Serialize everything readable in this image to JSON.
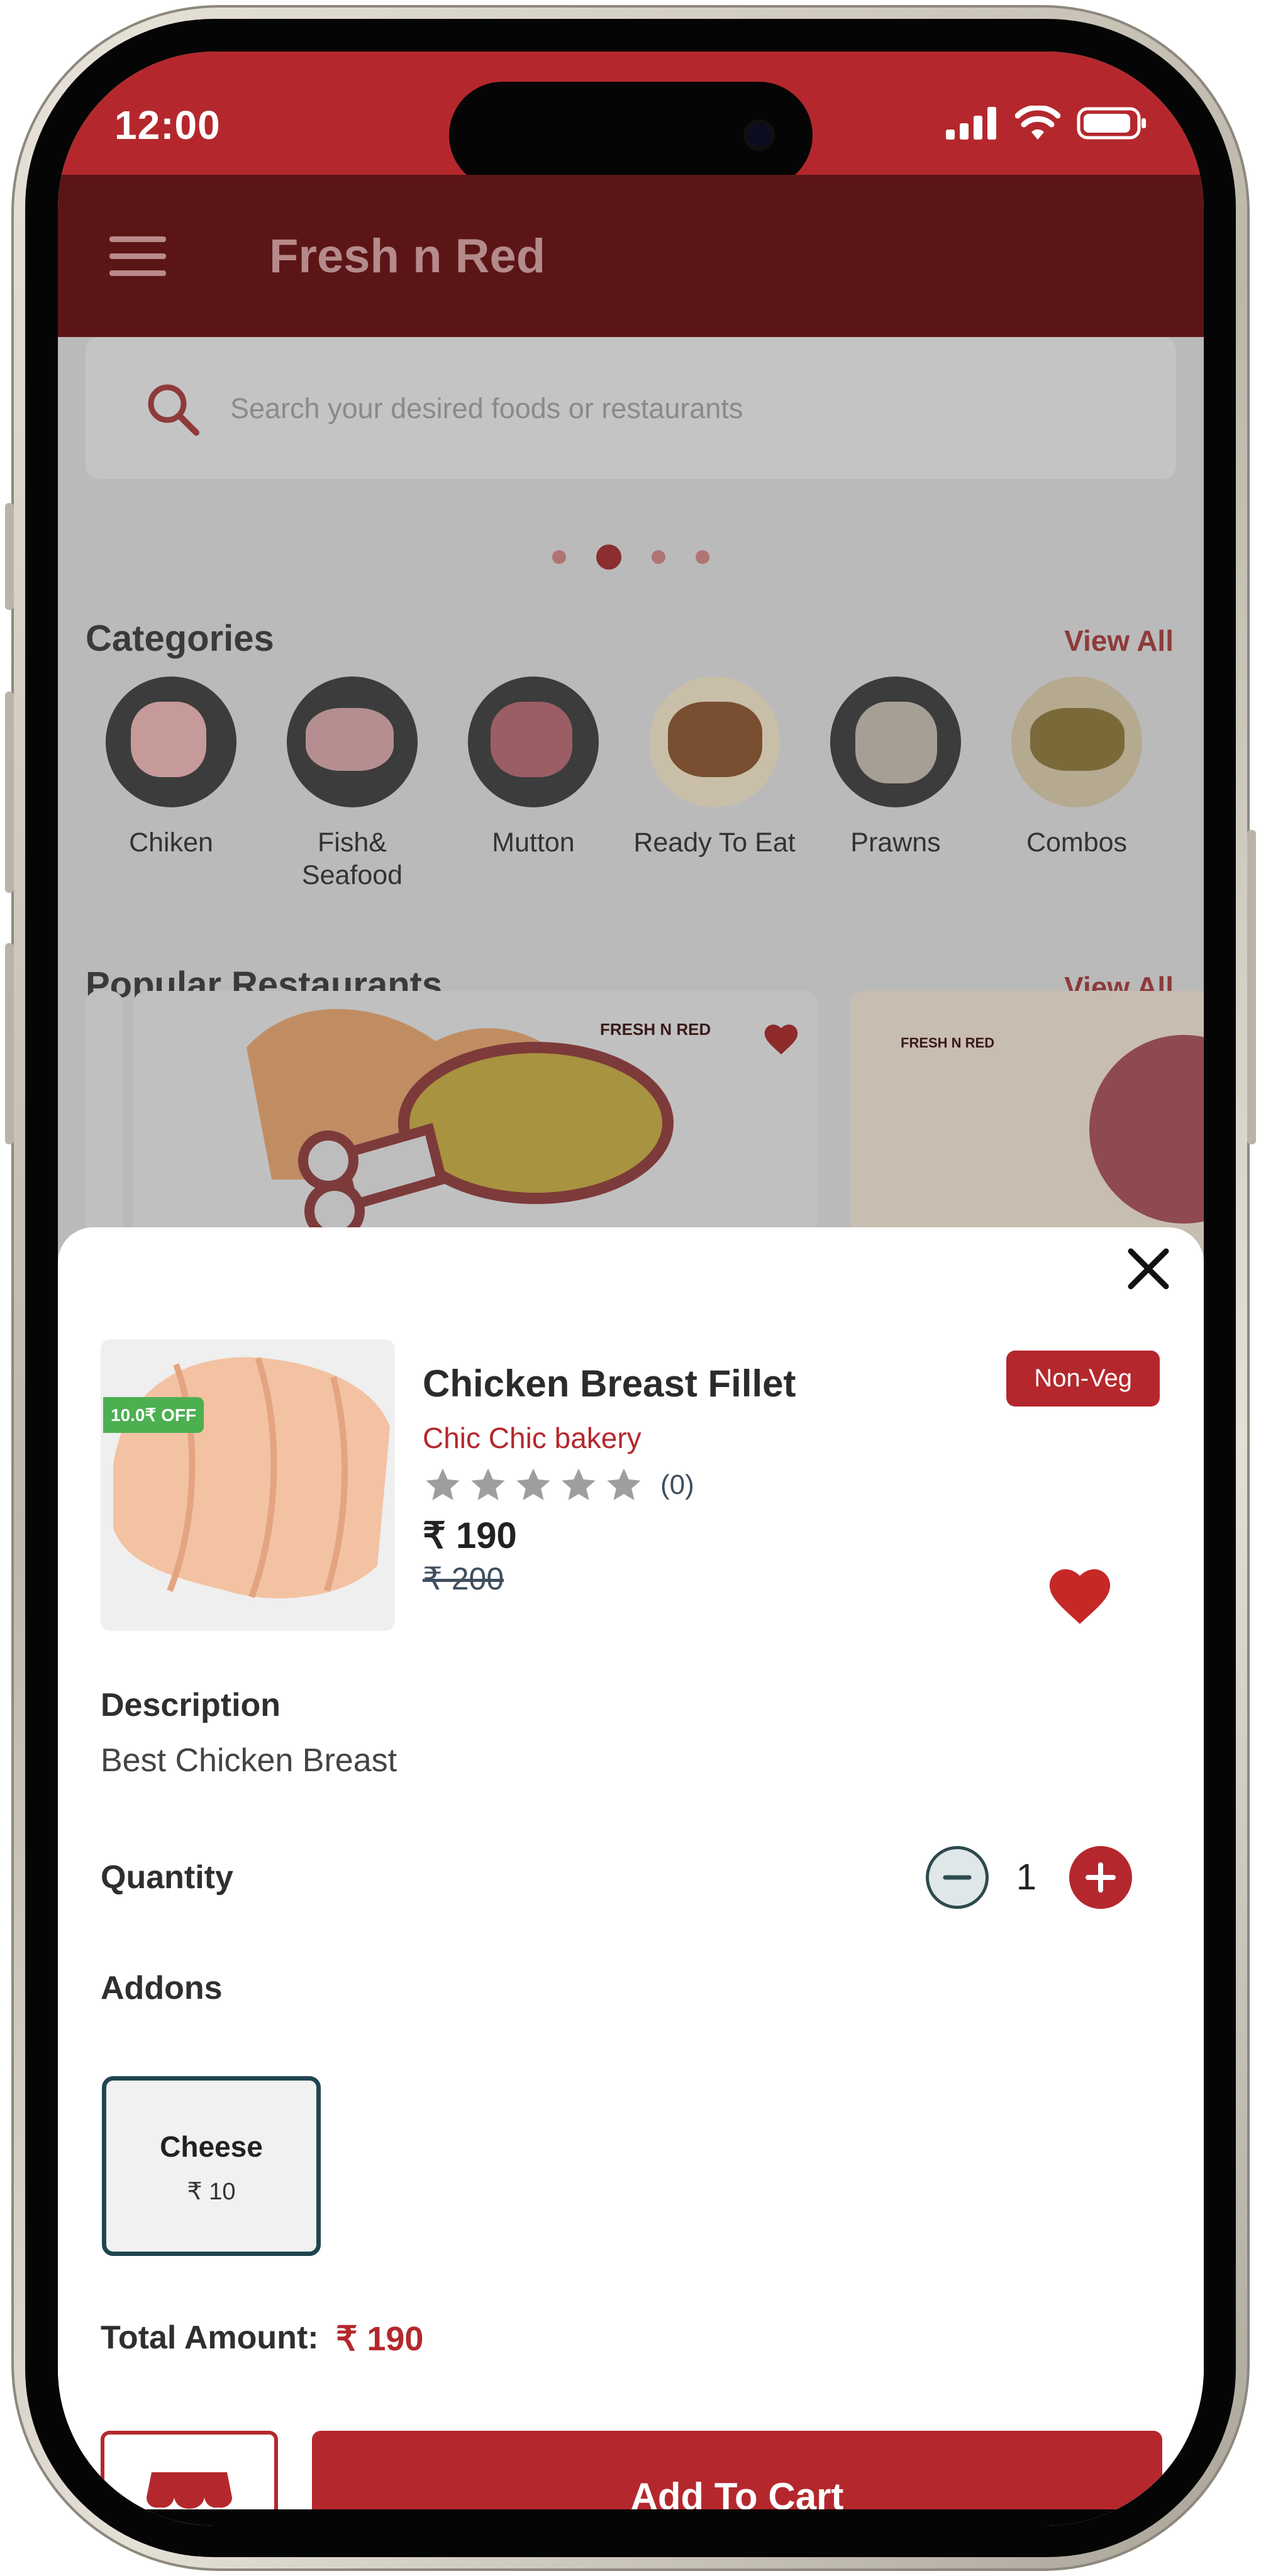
{
  "status_bar": {
    "time": "12:00"
  },
  "app_bar": {
    "title": "Fresh n Red"
  },
  "search": {
    "placeholder": "Search your desired foods or restaurants"
  },
  "categories": {
    "title": "Categories",
    "view_all": "View All",
    "items": [
      {
        "label": "Chiken"
      },
      {
        "label": "Fish& Seafood"
      },
      {
        "label": "Mutton"
      },
      {
        "label": "Ready To Eat"
      },
      {
        "label": "Prawns"
      },
      {
        "label": "Combos"
      }
    ]
  },
  "restaurants": {
    "title": "Popular Restaurants",
    "view_all": "View All",
    "cards": [
      {
        "logo_text": "FRESH N RED"
      },
      {
        "logo_text": "FRESH N RED"
      }
    ]
  },
  "product": {
    "name": "Chicken Breast Fillet",
    "shop": "Chic Chic bakery",
    "discount_badge": "10.0₹ OFF",
    "diet_tag": "Non-Veg",
    "rating_stars": 0,
    "rating_count": "(0)",
    "price": "₹ 190",
    "old_price": "₹ 200",
    "favorite": true
  },
  "description": {
    "label": "Description",
    "text": "Best Chicken Breast"
  },
  "quantity": {
    "label": "Quantity",
    "value": "1"
  },
  "addons": {
    "label": "Addons",
    "items": [
      {
        "name": "Cheese",
        "price": "₹ 10",
        "selected": true
      }
    ]
  },
  "total": {
    "label": "Total Amount:",
    "value": "₹ 190"
  },
  "actions": {
    "add_to_cart": "Add To Cart"
  },
  "colors": {
    "primary": "#b4282d",
    "appbar": "#5c1516",
    "badge_green": "#4caf50",
    "addon_border": "#1f4650"
  }
}
